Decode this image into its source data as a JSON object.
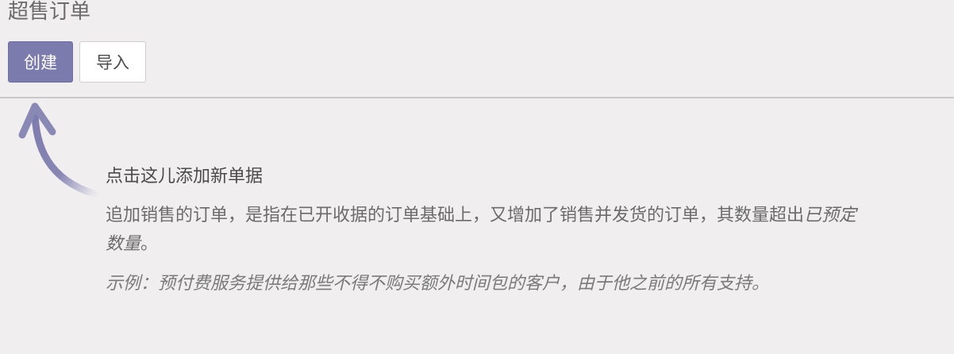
{
  "page": {
    "title": "超售订单"
  },
  "toolbar": {
    "create_label": "创建",
    "import_label": "导入"
  },
  "help": {
    "title": "点击这儿添加新单据",
    "body_text": "追加销售的订单，是指在已开收据的订单基础上，又增加了销售并发货的订单，其数量超出",
    "body_emphasis": "已预定数量",
    "body_end": "。",
    "example": "示例：预付费服务提供给那些不得不购买额外时间包的客户，由于他之前的所有支持。"
  },
  "colors": {
    "background": "#f0eeef",
    "primary_button": "#7c7bad",
    "arrow": "#7c7bad"
  },
  "icons": {
    "arrow": "curved-up-arrow-icon"
  }
}
